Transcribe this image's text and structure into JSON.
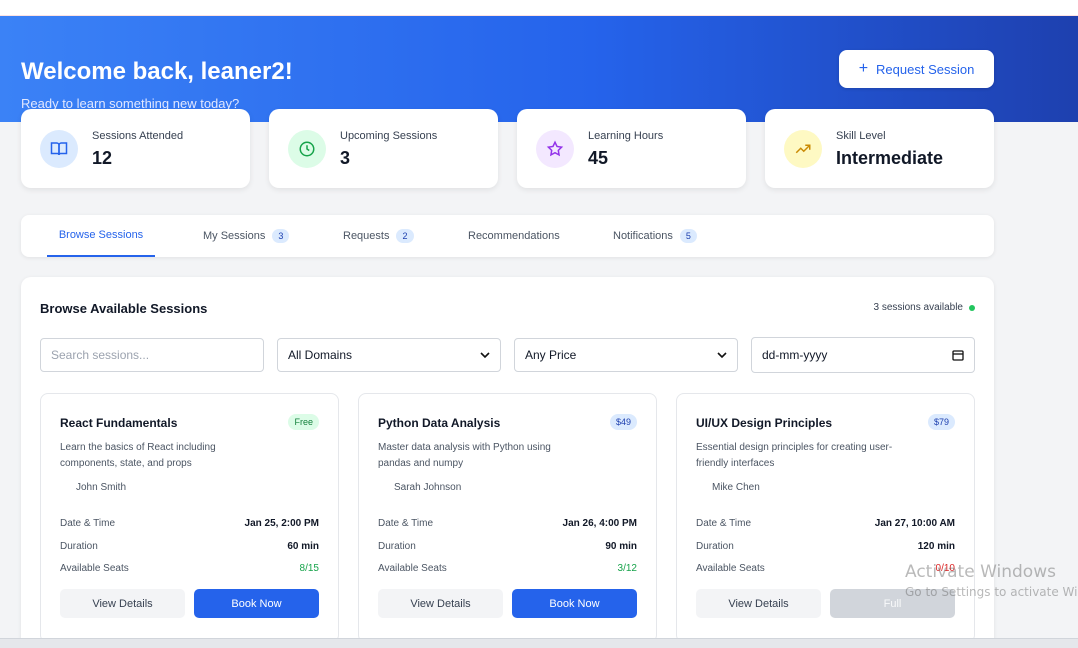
{
  "header": {
    "title": "Welcome back, leaner2!",
    "subtitle": "Ready to learn something new today?",
    "request_button": "Request Session",
    "plus": "+"
  },
  "stats": [
    {
      "label": "Sessions Attended",
      "value": "12",
      "icon": "book-icon",
      "color": "#2563eb",
      "bg": "#dbeafe"
    },
    {
      "label": "Upcoming Sessions",
      "value": "3",
      "icon": "clock-icon",
      "color": "#16a34a",
      "bg": "#dcfce7"
    },
    {
      "label": "Learning Hours",
      "value": "45",
      "icon": "star-icon",
      "color": "#9333ea",
      "bg": "#f3e8ff"
    },
    {
      "label": "Skill Level",
      "value": "Intermediate",
      "icon": "trending-up-icon",
      "color": "#ca8a04",
      "bg": "#fef9c3"
    }
  ],
  "tabs": [
    {
      "label": "Browse Sessions",
      "badge": null,
      "active": true
    },
    {
      "label": "My Sessions",
      "badge": "3"
    },
    {
      "label": "Requests",
      "badge": "2"
    },
    {
      "label": "Recommendations",
      "badge": null
    },
    {
      "label": "Notifications",
      "badge": "5"
    }
  ],
  "browse": {
    "title": "Browse Available Sessions",
    "available": "3 sessions available",
    "search_placeholder": "Search sessions...",
    "domain_select": "All Domains",
    "price_select": "Any Price",
    "date_placeholder": "dd-mm-yyyy"
  },
  "cards": [
    {
      "title": "React Fundamentals",
      "price": "Free",
      "desc": "Learn the basics of React including components, state, and props",
      "instructor": "John Smith",
      "date_label": "Date & Time",
      "date": "Jan 25, 2:00 PM",
      "duration_label": "Duration",
      "duration": "60 min",
      "seats_label": "Available Seats",
      "seats": "8/15",
      "view": "View Details",
      "action": "Book Now"
    },
    {
      "title": "Python Data Analysis",
      "price": "$49",
      "desc": "Master data analysis with Python using pandas and numpy",
      "instructor": "Sarah Johnson",
      "date_label": "Date & Time",
      "date": "Jan 26, 4:00 PM",
      "duration_label": "Duration",
      "duration": "90 min",
      "seats_label": "Available Seats",
      "seats": "3/12",
      "view": "View Details",
      "action": "Book Now"
    },
    {
      "title": "UI/UX Design Principles",
      "price": "$79",
      "desc": "Essential design principles for creating user-friendly interfaces",
      "instructor": "Mike Chen",
      "date_label": "Date & Time",
      "date": "Jan 27, 10:00 AM",
      "duration_label": "Duration",
      "duration": "120 min",
      "seats_label": "Available Seats",
      "seats": "0/10",
      "view": "View Details",
      "action": "Full"
    }
  ],
  "watermark": {
    "line1": "Activate Windows",
    "line2": "Go to Settings to activate Windows."
  }
}
